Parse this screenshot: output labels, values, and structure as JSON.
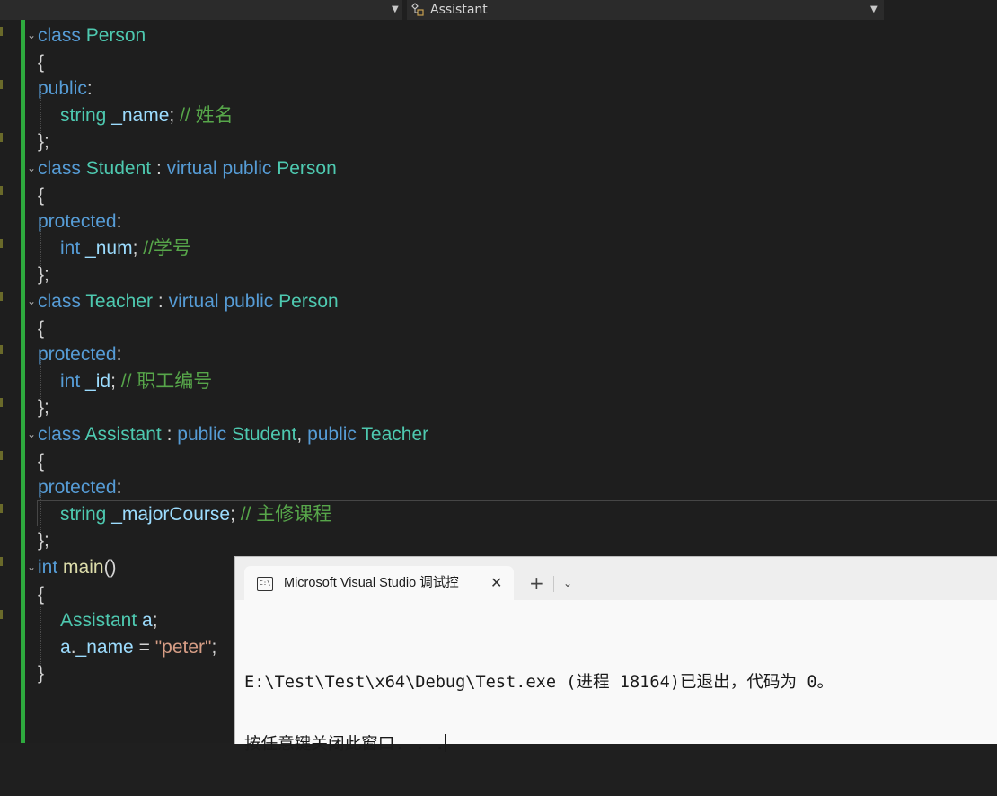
{
  "navbar": {
    "member_label": "Assistant",
    "member_icon": "class-members-icon"
  },
  "code_lines": [
    [
      "kw:class",
      "pl: ",
      "ty:Person"
    ],
    [
      "pl:{"
    ],
    [
      "kw:public",
      "pl::"
    ],
    [
      "ty:string",
      "pl: ",
      "vr:_name",
      "pl:; ",
      "cm:// 姓名"
    ],
    [
      "pl:};"
    ],
    [
      "kw:class",
      "pl: ",
      "ty:Student",
      "pl: : ",
      "kw:virtual",
      "pl: ",
      "kw:public",
      "pl: ",
      "ty:Person"
    ],
    [
      "pl:{"
    ],
    [
      "kw:protected",
      "pl::"
    ],
    [
      "kw:int",
      "pl: ",
      "vr:_num",
      "pl:; ",
      "cm://学号"
    ],
    [
      "pl:};"
    ],
    [
      "kw:class",
      "pl: ",
      "ty:Teacher",
      "pl: : ",
      "kw:virtual",
      "pl: ",
      "kw:public",
      "pl: ",
      "ty:Person"
    ],
    [
      "pl:{"
    ],
    [
      "kw:protected",
      "pl::"
    ],
    [
      "kw:int",
      "pl: ",
      "vr:_id",
      "pl:; ",
      "cm:// 职工编号"
    ],
    [
      "pl:};"
    ],
    [
      "kw:class",
      "pl: ",
      "ty:Assistant",
      "pl: : ",
      "kw:public",
      "pl: ",
      "ty:Student",
      "pl:, ",
      "kw:public",
      "pl: ",
      "ty:Teacher"
    ],
    [
      "pl:{"
    ],
    [
      "kw:protected",
      "pl::"
    ],
    [
      "ty:string",
      "pl: ",
      "vr:_majorCourse",
      "pl:; ",
      "cm:// 主修课程"
    ],
    [
      "pl:};"
    ],
    [
      "kw:int",
      "pl: ",
      "fn:main",
      "pl:()"
    ],
    [
      "pl:{"
    ],
    [
      "ty:Assistant",
      "pl: ",
      "vr:a",
      "pl:;"
    ],
    [
      "vr:a",
      "pl:.",
      "vr:_name",
      "pl: = ",
      "st:\"peter\"",
      "pl:;"
    ],
    [
      "pl:}"
    ]
  ],
  "console": {
    "tab_icon_text": "C:\\",
    "tab_title": "Microsoft Visual Studio 调试控",
    "close_glyph": "✕",
    "new_tab_glyph": "+",
    "dropdown_glyph": "⌄",
    "output_line_1": "E:\\Test\\Test\\x64\\Debug\\Test.exe (进程 18164)已退出，代码为 0。",
    "output_line_2": "按任意键关闭此窗口. . ."
  },
  "colors": {
    "keyword": "#569cd6",
    "type": "#4ec9b0",
    "comment": "#57a64a",
    "string": "#d69d85",
    "function": "#dcdcaa",
    "variable": "#9cdcfe",
    "change_bar": "#2eaa3e",
    "editor_bg": "#1e1e1e"
  }
}
